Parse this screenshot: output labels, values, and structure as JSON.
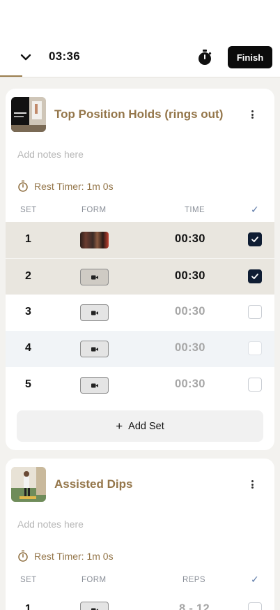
{
  "header": {
    "elapsed_time": "03:36",
    "finish_label": "Finish"
  },
  "exercises": [
    {
      "title": "Top Position Holds (rings out)",
      "notes_placeholder": "Add notes here",
      "rest_timer": "Rest Timer: 1m 0s",
      "columns": {
        "set": "SET",
        "form": "FORM",
        "metric": "TIME",
        "check": "✓"
      },
      "sets": [
        {
          "num": "1",
          "value": "00:30",
          "checked": true,
          "form": "video"
        },
        {
          "num": "2",
          "value": "00:30",
          "checked": true,
          "form": "camera"
        },
        {
          "num": "3",
          "value": "00:30",
          "checked": false,
          "form": "camera"
        },
        {
          "num": "4",
          "value": "00:30",
          "checked": false,
          "form": "camera"
        },
        {
          "num": "5",
          "value": "00:30",
          "checked": false,
          "form": "camera"
        }
      ],
      "add_set_label": "Add Set"
    },
    {
      "title": "Assisted Dips",
      "notes_placeholder": "Add notes here",
      "rest_timer": "Rest Timer: 1m 0s",
      "columns": {
        "set": "SET",
        "form": "FORM",
        "metric": "REPS",
        "check": "✓"
      },
      "sets": [
        {
          "num": "1",
          "value": "8 - 12",
          "checked": false,
          "form": "camera"
        }
      ]
    }
  ],
  "colors": {
    "accent": "#94764a",
    "checked": "#0f1d33",
    "done_row": "#e9e6df"
  }
}
